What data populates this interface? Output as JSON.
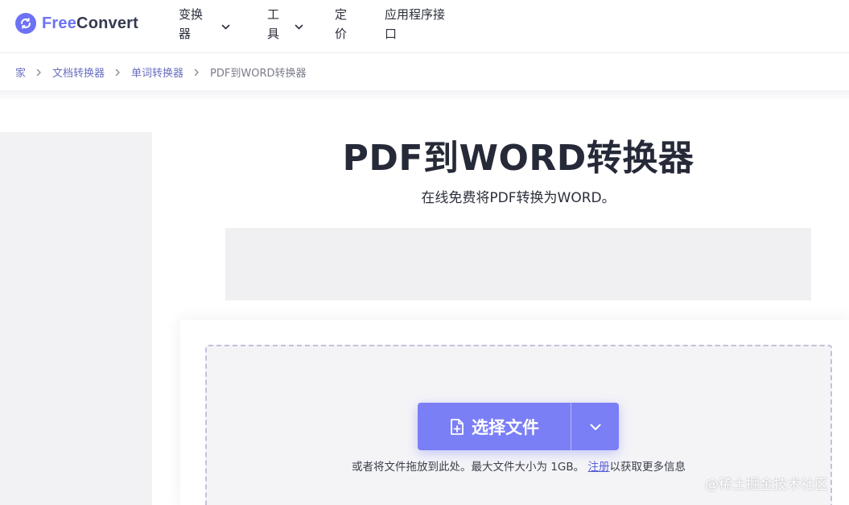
{
  "header": {
    "logo": {
      "free": "Free",
      "convert": "Convert"
    },
    "nav": {
      "convert_line1": "变换",
      "convert_line2": "器",
      "tools_line1": "工",
      "tools_line2": "具",
      "pricing_line1": "定",
      "pricing_line2": "价",
      "api_line1": "应用程序接",
      "api_line2": "口"
    }
  },
  "breadcrumb": [
    "家",
    "文档转换器",
    "单词转换器",
    "PDF到WORD转换器"
  ],
  "main": {
    "title": "PDF到WORD转换器",
    "subtitle": "在线免费将PDF转换为WORD。"
  },
  "upload": {
    "choose_label": "选择文件",
    "hint_prefix": "或者将文件拖放到此处。最大文件大小为 1GB。",
    "hint_link": "注册",
    "hint_suffix": "以获取更多信息"
  },
  "watermark": "@稀土掘金技术社区",
  "colors": {
    "accent": "#7b7ff5",
    "brand": "#6c72f5",
    "link": "#6a6fbf",
    "title": "#262a38",
    "dashed_border": "#c4c0dc"
  },
  "icons": {
    "logo": "refresh-circle-icon",
    "nav_chevron": "chevron-down-icon",
    "breadcrumb_sep": "chevron-right-icon",
    "choose": "file-plus-icon",
    "dropdown": "chevron-down-icon"
  }
}
